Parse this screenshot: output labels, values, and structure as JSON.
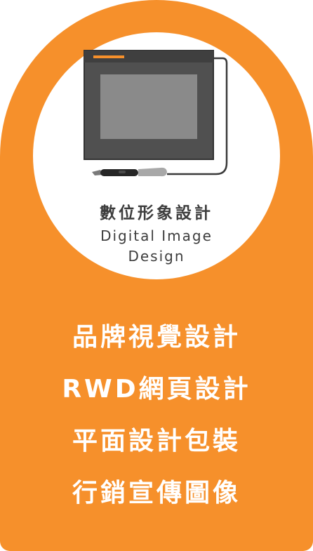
{
  "colors": {
    "card_background": "#f6902b",
    "circle_background": "#ffffff",
    "accent_bar": "#f6902b",
    "text_dark": "#3d3d3d",
    "text_light": "#ffffff"
  },
  "illustration": {
    "icon": "drawing-tablet-with-pen-icon"
  },
  "circle": {
    "title_zh": "數位形象設計",
    "title_en_line1": "Digital Image",
    "title_en_line2": "Design"
  },
  "services": [
    "品牌視覺設計",
    "RWD網頁設計",
    "平面設計包裝",
    "行銷宣傳圖像"
  ]
}
